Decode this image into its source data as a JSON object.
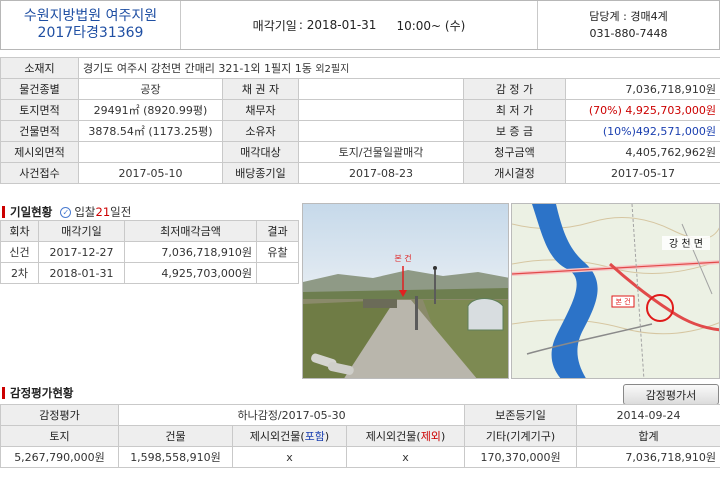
{
  "header": {
    "court": "수원지방법원 여주지원",
    "case_no": "2017타경31369",
    "auction_label": "매각기일",
    "auction_date": ": 2018-01-31",
    "auction_time": "10:00~ (수)",
    "dept": "담당계 : 경매4계",
    "phone": "031-880-7448"
  },
  "property": {
    "labels": {
      "location": "소재지",
      "type": "물건종별",
      "land_area": "토지면적",
      "building_area": "건물면적",
      "excluded_area": "제시외면적",
      "case_received": "사건접수",
      "creditor": "채 권 자",
      "debtor": "채무자",
      "owner": "소유자",
      "sale_target": "매각대상",
      "dividend_deadline": "배당종기일",
      "appraisal": "감 정 가",
      "minimum": "최 저 가",
      "deposit": "보 증 금",
      "claim": "청구금액",
      "start_decision": "개시결정"
    },
    "location": "경기도 여주시 강천면 간매리 321-1외 1필지 1동",
    "location_extra": "외2필지",
    "type": "공장",
    "land_area": "29491㎡ (8920.99평)",
    "building_area": "3878.54㎡ (1173.25평)",
    "excluded_area": "",
    "case_received": "2017-05-10",
    "creditor": "",
    "debtor": "",
    "owner": "",
    "sale_target": "토지/건물일괄매각",
    "dividend_deadline": "2017-08-23",
    "appraisal": "7,036,718,910원",
    "minimum": "(70%) 4,925,703,000원",
    "deposit": "(10%)492,571,000원",
    "claim": "4,405,762,962원",
    "start_decision": "2017-05-17"
  },
  "bidding": {
    "title": "기일현황",
    "note_pre": "입찰",
    "note_days": "21",
    "note_post": "일전",
    "headers": [
      "회차",
      "매각기일",
      "최저매각금액",
      "결과"
    ],
    "rows": [
      {
        "round": "신건",
        "date": "2017-12-27",
        "amount": "7,036,718,910원",
        "result": "유찰"
      },
      {
        "round": "2차",
        "date": "2018-01-31",
        "amount": "4,925,703,000원",
        "result": ""
      }
    ]
  },
  "photo": {
    "label": "본 건"
  },
  "map": {
    "label": "강 천 면",
    "marker": "본 건"
  },
  "appraisal_section": {
    "title": "감정평가현황",
    "button": "감정평가서",
    "row1": {
      "label": "감정평가",
      "value": "하나감정/2017-05-30",
      "submit_label": "보존등기일",
      "submit_value": "2014-09-24"
    },
    "headers": {
      "land": "토지",
      "building": "건물",
      "excl_inc_pre": "제시외건물(",
      "excl_inc_mid": "포함",
      "excl_inc_post": ")",
      "excl_exc_pre": "제시외건물(",
      "excl_exc_mid": "제외",
      "excl_exc_post": ")",
      "other": "기타(기계기구)",
      "total": "합계"
    },
    "values": {
      "land": "5,267,790,000원",
      "building": "1,598,558,910원",
      "excl_inc": "x",
      "excl_exc": "x",
      "other": "170,370,000원",
      "total": "7,036,718,910원"
    }
  }
}
